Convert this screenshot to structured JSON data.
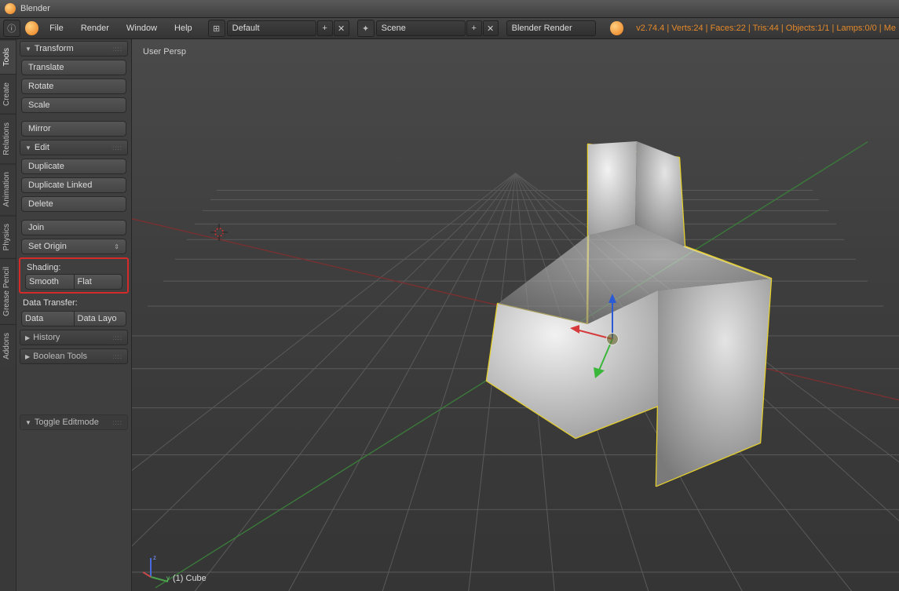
{
  "titlebar": {
    "app_name": "Blender"
  },
  "menubar": {
    "items": [
      "File",
      "Render",
      "Window",
      "Help"
    ],
    "layout_label": "Default",
    "scene_label": "Scene",
    "engine_label": "Blender Render",
    "stats": "v2.74.4 | Verts:24 | Faces:22 | Tris:44 | Objects:1/1 | Lamps:0/0 | Me"
  },
  "vtabs": [
    "Tools",
    "Create",
    "Relations",
    "Animation",
    "Physics",
    "Grease Pencil",
    "Addons"
  ],
  "toolpanel": {
    "transform": {
      "title": "Transform",
      "buttons": [
        "Translate",
        "Rotate",
        "Scale",
        "Mirror"
      ]
    },
    "edit": {
      "title": "Edit",
      "buttons": [
        "Duplicate",
        "Duplicate Linked",
        "Delete",
        "Join"
      ],
      "set_origin_label": "Set Origin",
      "shading_label": "Shading:",
      "smooth_label": "Smooth",
      "flat_label": "Flat",
      "data_transfer_label": "Data Transfer:",
      "data_label": "Data",
      "data_layo_label": "Data Layo"
    },
    "history_title": "History",
    "boolean_title": "Boolean Tools",
    "toggle_edit_title": "Toggle Editmode"
  },
  "viewport": {
    "persp_label": "User Persp",
    "object_label": "(1) Cube"
  }
}
